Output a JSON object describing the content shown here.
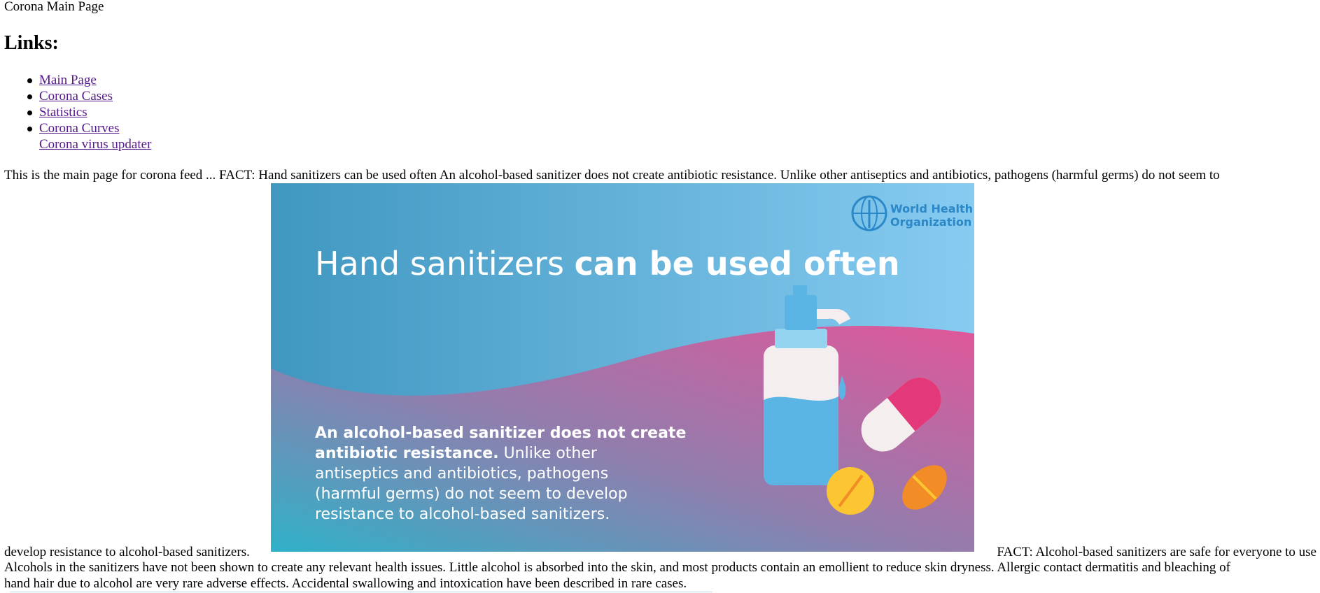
{
  "page_title": "Corona Main Page",
  "links_heading": "Links:",
  "links": [
    {
      "label": "Main Page",
      "bulleted": true
    },
    {
      "label": "Corona Cases",
      "bulleted": true
    },
    {
      "label": "Statistics",
      "bulleted": true
    },
    {
      "label": "Corona Curves",
      "bulleted": true
    },
    {
      "label": "Corona virus updater",
      "bulleted": false
    }
  ],
  "content": {
    "intro_line": "This is the main page for corona feed ... FACT: Hand sanitizers can be used often An alcohol-based sanitizer does not create antibiotic resistance. Unlike other antiseptics and antibiotics, pathogens (harmful germs) do not seem to",
    "intro_tail": "develop resistance to alcohol-based sanitizers.",
    "fact2_heading": "FACT: Alcohol-based sanitizers are safe for everyone to use",
    "fact2_line1": "Alcohols in the sanitizers have not been shown to create any relevant health issues. Little alcohol is absorbed into the skin, and most products contain an emollient to reduce skin dryness. Allergic contact dermatitis and bleaching of",
    "fact2_line2": "hand hair due to alcohol are very rare adverse effects. Accidental swallowing and intoxication have been described in rare cases."
  },
  "banner": {
    "logo_line1": "World Health",
    "logo_line2": "Organization",
    "headline_light": "Hand sanitizers ",
    "headline_bold": "can be used often",
    "body_bold_1": "An alcohol-based sanitizer does not create",
    "body_bold_2": "antibiotic resistance.",
    "body_light_2": " Unlike other",
    "body_light_3": "antiseptics and antibiotics, pathogens",
    "body_light_4": "(harmful germs) do not seem to develop",
    "body_light_5": "resistance to alcohol-based sanitizers.",
    "colors": {
      "sky_left": "#3f97c0",
      "sky_right": "#87cbf1",
      "pink": "#e0579a",
      "teal": "#2fb1c8",
      "logo_blue": "#2b88c8",
      "bottle_blue": "#5bb5e4",
      "pill_pink": "#e3397a",
      "tablet_yellow": "#fbc632",
      "tablet_orange": "#f28c27"
    }
  }
}
